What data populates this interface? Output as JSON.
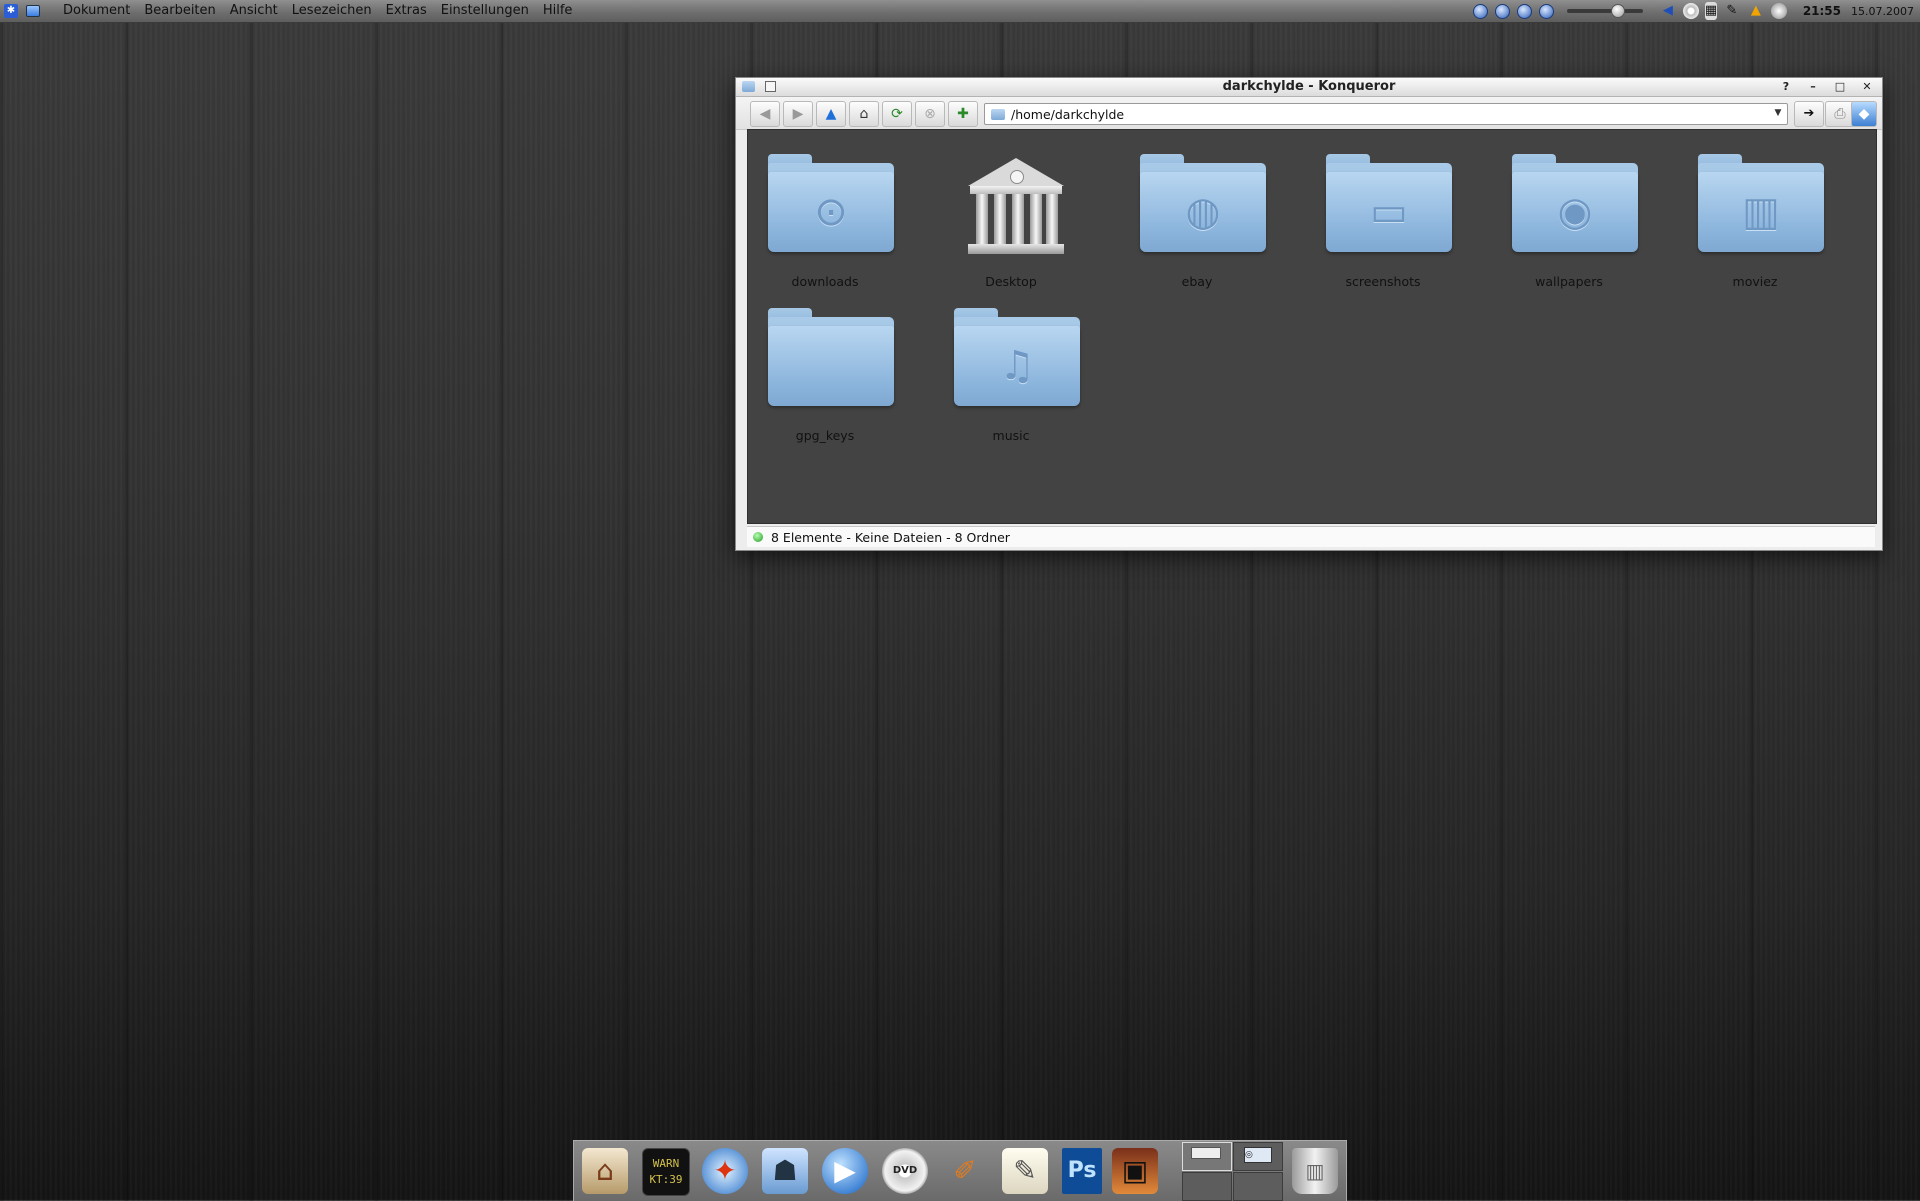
{
  "menubar": {
    "kde_icon": "kde-icon",
    "menus": [
      "Dokument",
      "Bearbeiten",
      "Ansicht",
      "Lesezeichen",
      "Extras",
      "Einstellungen",
      "Hilfe"
    ],
    "clock": "21:55",
    "date": "15.07.2007",
    "volume": 0.66
  },
  "window": {
    "title": "darkchylde - Konqueror",
    "buttons": {
      "help": "?",
      "minimize": "–",
      "maximize": "□",
      "close": "✕"
    },
    "location": "/home/darkchylde",
    "icons": [
      {
        "label": "downloads",
        "emblem": "download-icon"
      },
      {
        "label": "Desktop",
        "emblem": "library-icon"
      },
      {
        "label": "ebay",
        "emblem": "globe-icon"
      },
      {
        "label": "screenshots",
        "emblem": "window-icon"
      },
      {
        "label": "wallpapers",
        "emblem": "camera-icon"
      },
      {
        "label": "moviez",
        "emblem": "film-icon"
      },
      {
        "label": "gpg_keys",
        "emblem": "none"
      },
      {
        "label": "music",
        "emblem": "music-note-icon"
      }
    ],
    "status": "8 Elemente - Keine Dateien - 8 Ordner"
  },
  "dock": {
    "console_text": "WARN\nKT:39",
    "ps_label": "Ps",
    "dvd_label": "DVD"
  },
  "colors": {
    "folder": "#8db6dd",
    "accent": "#2b5ed6"
  }
}
